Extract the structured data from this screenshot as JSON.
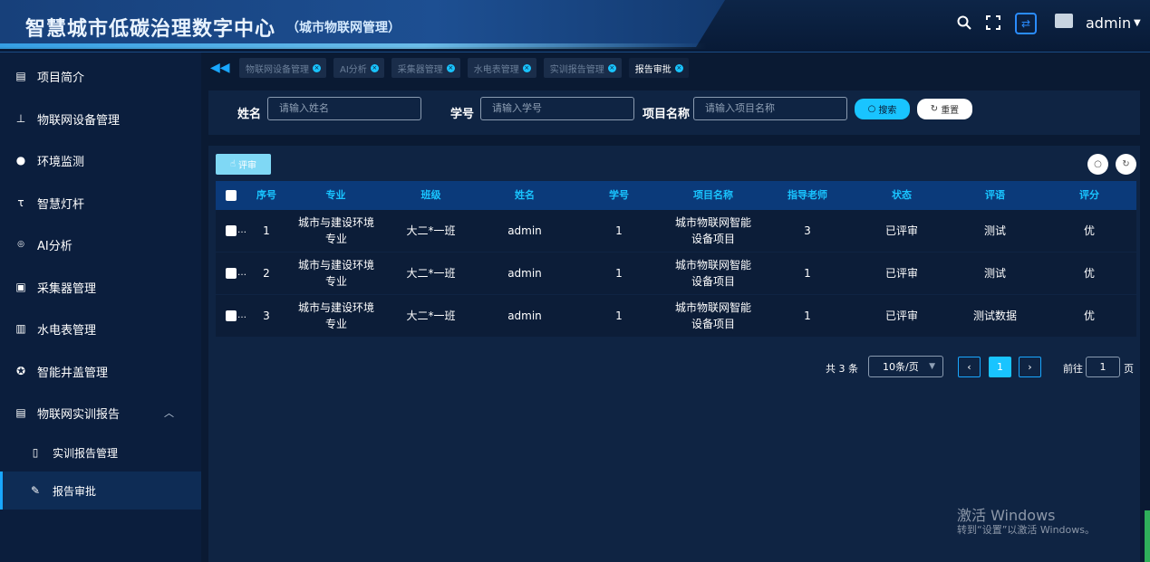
{
  "header": {
    "title": "智慧城市低碳治理数字中心",
    "subtitle": "（城市物联网管理）",
    "user": "admin",
    "icons": [
      "search-icon",
      "fullscreen-icon",
      "switch-icon",
      "avatar",
      "caret-down-icon"
    ]
  },
  "sidebar": {
    "items": [
      {
        "label": "项目简介",
        "icon": "document-icon"
      },
      {
        "label": "物联网设备管理",
        "icon": "sitemap-icon"
      },
      {
        "label": "环境监测",
        "icon": "globe-icon"
      },
      {
        "label": "智慧灯杆",
        "icon": "text-height-icon"
      },
      {
        "label": "AI分析",
        "icon": "ai-icon"
      },
      {
        "label": "采集器管理",
        "icon": "printer-icon"
      },
      {
        "label": "水电表管理",
        "icon": "meter-icon"
      },
      {
        "label": "智能井盖管理",
        "icon": "lifebuoy-icon"
      },
      {
        "label": "物联网实训报告",
        "icon": "report-icon",
        "expanded": true
      }
    ],
    "submenu": [
      {
        "label": "实训报告管理",
        "icon": "book-icon",
        "active": false
      },
      {
        "label": "报告审批",
        "icon": "edit-icon",
        "active": true
      }
    ]
  },
  "tabs": [
    {
      "label": "物联网设备管理",
      "active": false
    },
    {
      "label": "AI分析",
      "active": false
    },
    {
      "label": "采集器管理",
      "active": false
    },
    {
      "label": "水电表管理",
      "active": false
    },
    {
      "label": "实训报告管理",
      "active": false
    },
    {
      "label": "报告审批",
      "active": true
    }
  ],
  "search": {
    "name_label": "姓名",
    "name_placeholder": "请输入姓名",
    "id_label": "学号",
    "id_placeholder": "请输入学号",
    "project_label": "项目名称",
    "project_placeholder": "请输入项目名称",
    "search_btn": "搜索",
    "reset_btn": "重置"
  },
  "toolbar": {
    "review_btn": "评审"
  },
  "table": {
    "columns": [
      "序号",
      "专业",
      "班级",
      "姓名",
      "学号",
      "项目名称",
      "指导老师",
      "状态",
      "评语",
      "评分"
    ],
    "rows": [
      {
        "no": "1",
        "major": "城市与建设环境专业",
        "class": "大二*一班",
        "name": "admin",
        "sid": "1",
        "project": "城市物联网智能设备项目",
        "teacher": "3",
        "status": "已评审",
        "comment": "测试",
        "score": "优"
      },
      {
        "no": "2",
        "major": "城市与建设环境专业",
        "class": "大二*一班",
        "name": "admin",
        "sid": "1",
        "project": "城市物联网智能设备项目",
        "teacher": "1",
        "status": "已评审",
        "comment": "测试",
        "score": "优"
      },
      {
        "no": "3",
        "major": "城市与建设环境专业",
        "class": "大二*一班",
        "name": "admin",
        "sid": "1",
        "project": "城市物联网智能设备项目",
        "teacher": "1",
        "status": "已评审",
        "comment": "测试数据",
        "score": "优"
      }
    ]
  },
  "pagination": {
    "total": "共 3 条",
    "page_size": "10条/页",
    "current": "1",
    "goto_label": "前往",
    "goto_value": "1",
    "page_suffix": "页"
  },
  "watermark": {
    "line1": "激活 Windows",
    "line2": "转到“设置”以激活 Windows。"
  },
  "colors": {
    "accent": "#19c4ff",
    "header_bg": "#081a36",
    "panel_bg": "#0f2443",
    "table_head_bg": "#0b3a7a"
  }
}
